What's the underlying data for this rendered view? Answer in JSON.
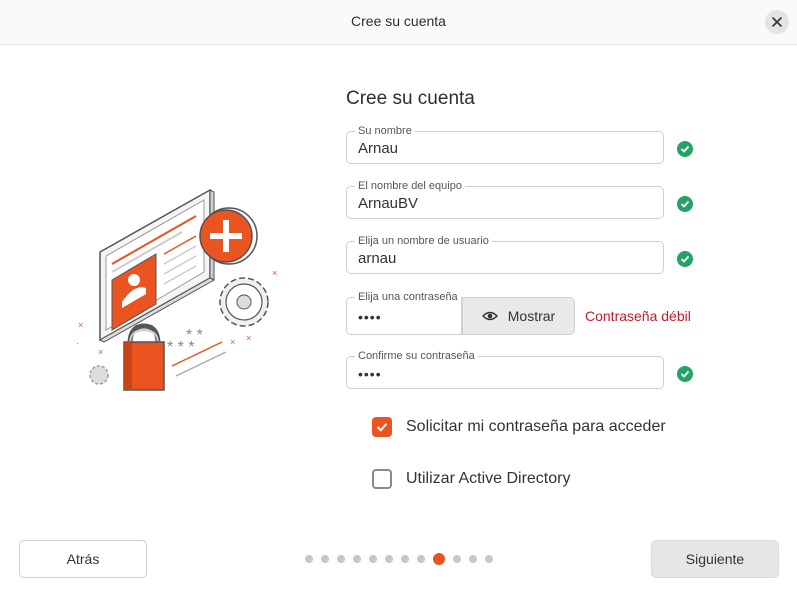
{
  "window": {
    "title": "Cree su cuenta"
  },
  "heading": "Cree su cuenta",
  "fields": {
    "name": {
      "label": "Su nombre",
      "value": "Arnau",
      "valid": true
    },
    "computer": {
      "label": "El nombre del equipo",
      "value": "ArnauBV",
      "valid": true
    },
    "username": {
      "label": "Elija un nombre de usuario",
      "value": "arnau",
      "valid": true
    },
    "password": {
      "label": "Elija una contraseña",
      "value": "••••",
      "show_label": "Mostrar",
      "strength": "Contraseña débil"
    },
    "confirm": {
      "label": "Confirme su contraseña",
      "value": "••••",
      "valid": true
    }
  },
  "options": {
    "require_password": {
      "label": "Solicitar mi contraseña para acceder",
      "checked": true
    },
    "active_directory": {
      "label": "Utilizar Active Directory",
      "checked": false
    }
  },
  "nav": {
    "back_label": "Atrás",
    "next_label": "Siguiente"
  },
  "progress": {
    "total_steps": 12,
    "current_step": 9
  },
  "colors": {
    "accent": "#e95420",
    "valid": "#26a269",
    "error": "#c01c28"
  },
  "icons": [
    "close-icon",
    "check-icon",
    "eye-icon",
    "account-illustration"
  ]
}
